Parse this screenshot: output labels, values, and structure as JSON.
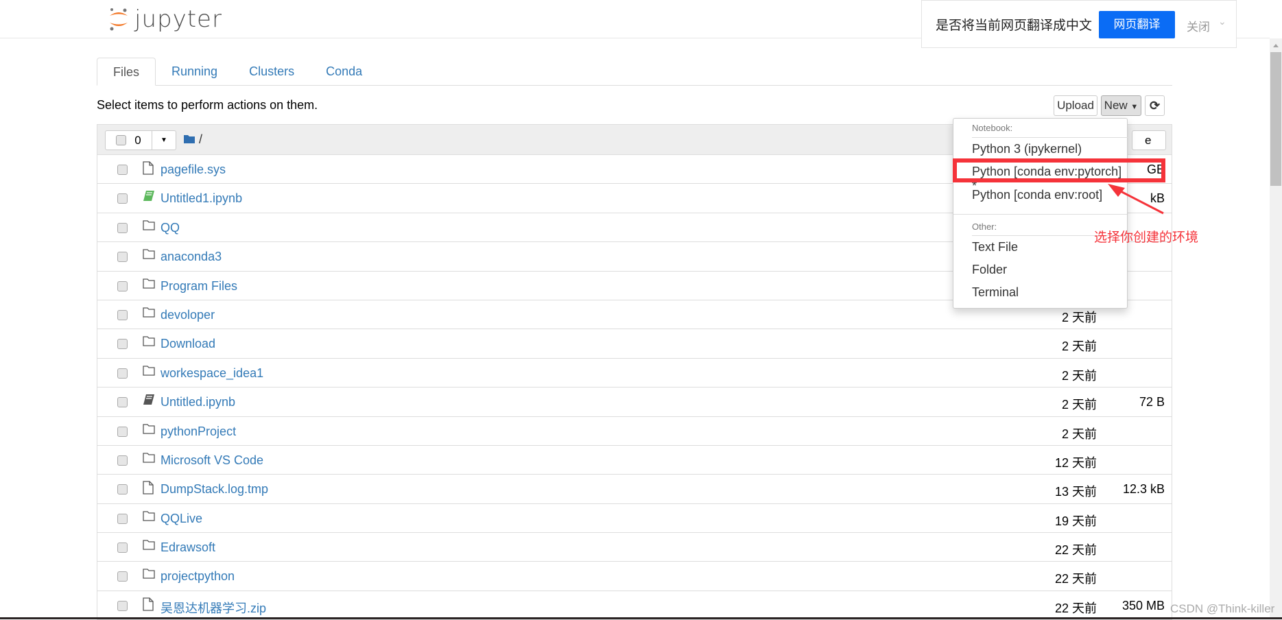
{
  "header": {
    "logo_text": "jupyter"
  },
  "tabs": [
    {
      "label": "Files",
      "active": true
    },
    {
      "label": "Running"
    },
    {
      "label": "Clusters"
    },
    {
      "label": "Conda"
    }
  ],
  "hint": "Select items to perform actions on them.",
  "toolbar": {
    "upload": "Upload",
    "new": "New",
    "refresh_icon": "refresh-icon"
  },
  "list_header": {
    "selected_count": "0",
    "path": "/",
    "partial_hidden_text": "e"
  },
  "files": [
    {
      "name": "pagefile.sys",
      "type": "file",
      "modified": "",
      "size": "GB"
    },
    {
      "name": "Untitled1.ipynb",
      "type": "notebook-running",
      "modified": "",
      "size": "kB"
    },
    {
      "name": "QQ",
      "type": "folder",
      "modified": "",
      "size": ""
    },
    {
      "name": "anaconda3",
      "type": "folder",
      "modified": "",
      "size": ""
    },
    {
      "name": "Program Files",
      "type": "folder",
      "modified": "",
      "size": ""
    },
    {
      "name": "devoloper",
      "type": "folder",
      "modified": "2 天前",
      "size": ""
    },
    {
      "name": "Download",
      "type": "folder",
      "modified": "2 天前",
      "size": ""
    },
    {
      "name": "workespace_idea1",
      "type": "folder",
      "modified": "2 天前",
      "size": ""
    },
    {
      "name": "Untitled.ipynb",
      "type": "notebook",
      "modified": "2 天前",
      "size": "72 B"
    },
    {
      "name": "pythonProject",
      "type": "folder",
      "modified": "2 天前",
      "size": ""
    },
    {
      "name": "Microsoft VS Code",
      "type": "folder",
      "modified": "12 天前",
      "size": ""
    },
    {
      "name": "DumpStack.log.tmp",
      "type": "file",
      "modified": "13 天前",
      "size": "12.3 kB"
    },
    {
      "name": "QQLive",
      "type": "folder",
      "modified": "19 天前",
      "size": ""
    },
    {
      "name": "Edrawsoft",
      "type": "folder",
      "modified": "22 天前",
      "size": ""
    },
    {
      "name": "projectpython",
      "type": "folder",
      "modified": "22 天前",
      "size": ""
    },
    {
      "name": "吴恩达机器学习.zip",
      "type": "file",
      "modified": "22 天前",
      "size": "350 MB"
    }
  ],
  "new_menu": {
    "notebook_header": "Notebook:",
    "notebook_items": [
      "Python 3 (ipykernel)",
      "Python [conda env:pytorch] *",
      "Python [conda env:root]"
    ],
    "other_header": "Other:",
    "other_items": [
      "Text File",
      "Folder",
      "Terminal"
    ]
  },
  "annotation": {
    "text": "选择你创建的环境",
    "color": "#f5333a"
  },
  "translate_popup": {
    "question": "是否将当前网页翻译成中文",
    "translate": "网页翻译",
    "close": "关闭"
  },
  "watermark": "CSDN @Think-killer",
  "colors": {
    "link": "#337ab7",
    "translate_button": "#0a6cf5",
    "annotation": "#f5333a"
  }
}
